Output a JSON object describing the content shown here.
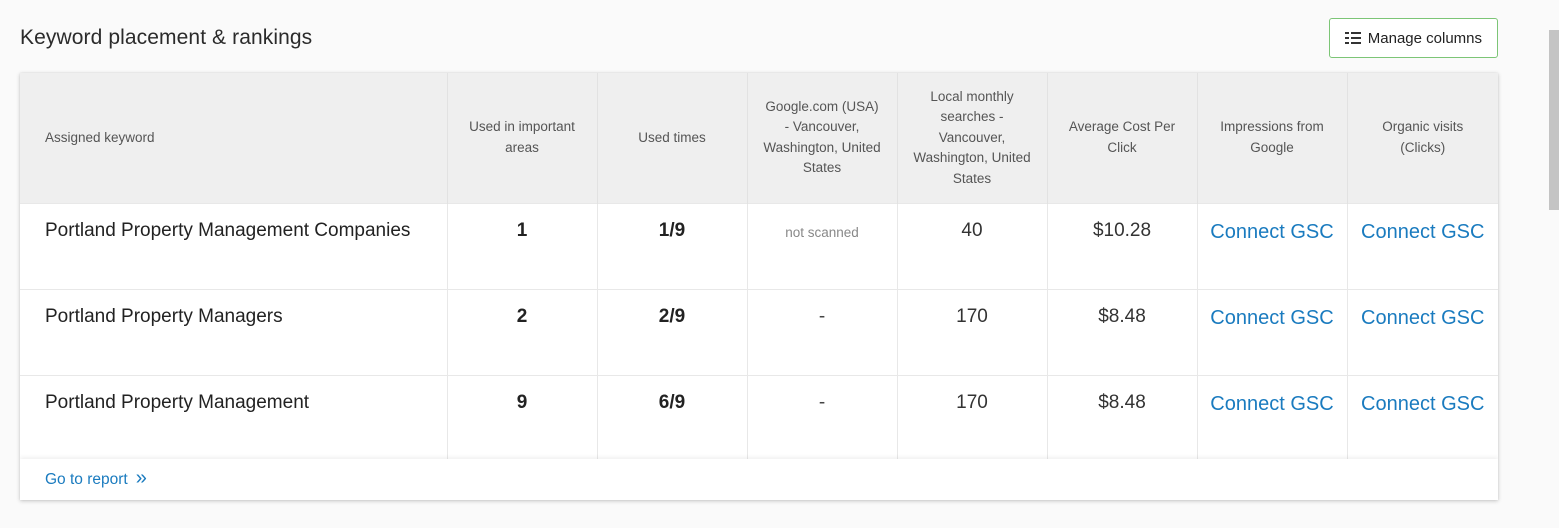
{
  "header": {
    "title": "Keyword placement & rankings",
    "manage_columns_label": "Manage columns"
  },
  "table": {
    "columns": [
      "Assigned keyword",
      "Used in important areas",
      "Used times",
      "Google.com (USA) - Vancouver, Washington, United States",
      "Local monthly searches - Vancouver, Washington, United States",
      "Average Cost Per Click",
      "Impressions from Google",
      "Organic visits (Clicks)"
    ],
    "rows": [
      {
        "keyword": "Portland Property Management Companies",
        "important_areas": "1",
        "used_times": "1/9",
        "ranking": "not scanned",
        "monthly_searches": "40",
        "cpc": "$10.28",
        "impressions": "Connect GSC",
        "organic_visits": "Connect GSC"
      },
      {
        "keyword": "Portland Property Managers",
        "important_areas": "2",
        "used_times": "2/9",
        "ranking": "-",
        "monthly_searches": "170",
        "cpc": "$8.48",
        "impressions": "Connect GSC",
        "organic_visits": "Connect GSC"
      },
      {
        "keyword": "Portland Property Management",
        "important_areas": "9",
        "used_times": "6/9",
        "ranking": "-",
        "monthly_searches": "170",
        "cpc": "$8.48",
        "impressions": "Connect GSC",
        "organic_visits": "Connect GSC"
      }
    ]
  },
  "footer": {
    "go_to_report_label": "Go to report",
    "chevron": "»"
  },
  "icons": {
    "manage_columns": "columns-list-icon",
    "go_to_report": "double-chevron-right-icon"
  },
  "colors": {
    "link": "#1a7bbf",
    "button_border": "#7cc576",
    "header_bg": "#efefef"
  }
}
